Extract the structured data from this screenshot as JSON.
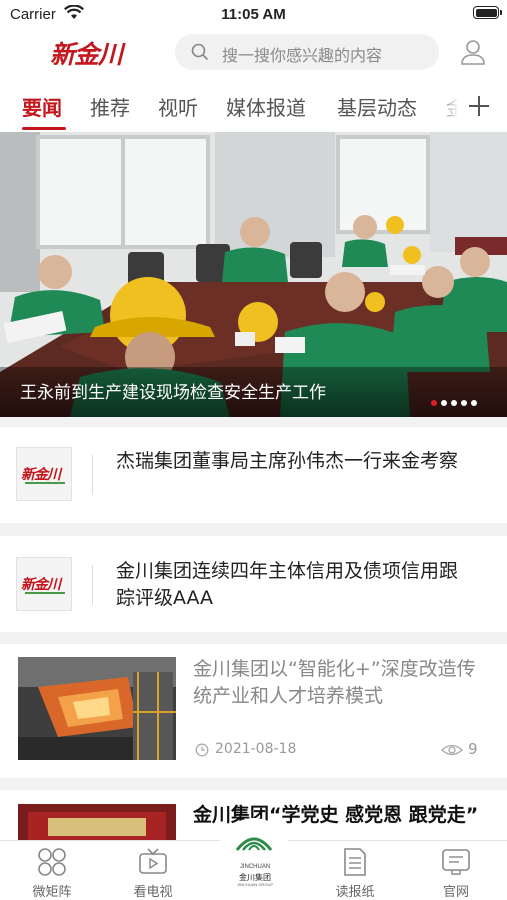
{
  "status_bar": {
    "carrier": "Carrier",
    "time": "11:05 AM"
  },
  "header": {
    "logo_text": "新金川",
    "search_placeholder": "搜一搜你感兴趣的内容"
  },
  "tabs": [
    {
      "label": "要闻",
      "active": true
    },
    {
      "label": "推荐",
      "active": false
    },
    {
      "label": "视听",
      "active": false
    },
    {
      "label": "媒体报道",
      "active": false
    },
    {
      "label": "基层动态",
      "active": false
    },
    {
      "label": "金",
      "active": false
    }
  ],
  "banner": {
    "caption": "王永前到生产建设现场检查安全生产工作",
    "slide_count": 5,
    "active_slide": 1
  },
  "news": [
    {
      "thumb": "logo",
      "title": "杰瑞集团董事局主席孙伟杰一行来金考察"
    },
    {
      "thumb": "logo",
      "title": "金川集团连续四年主体信用及债项信用跟踪评级AAA"
    },
    {
      "thumb": "photo",
      "title": "金川集团以“智能化+”深度改造传统产业和人才培养模式",
      "date": "2021-08-18",
      "views": "9"
    },
    {
      "thumb": "photo",
      "title": "金川集团“学党史 感党恩 跟党走”"
    }
  ],
  "bottom_nav": {
    "items": [
      {
        "label": "微矩阵",
        "icon": "grid-icon"
      },
      {
        "label": "看电视",
        "icon": "tv-icon"
      },
      {
        "label": "读报纸",
        "icon": "newspaper-icon"
      },
      {
        "label": "官网",
        "icon": "website-icon"
      }
    ],
    "center": {
      "brand_en": "JINCHUAN",
      "brand_cn": "金川集团",
      "brand_sub": "JINCHUAN GROUP"
    }
  },
  "colors": {
    "accent": "#c4161c",
    "active_dot": "#e02020"
  }
}
